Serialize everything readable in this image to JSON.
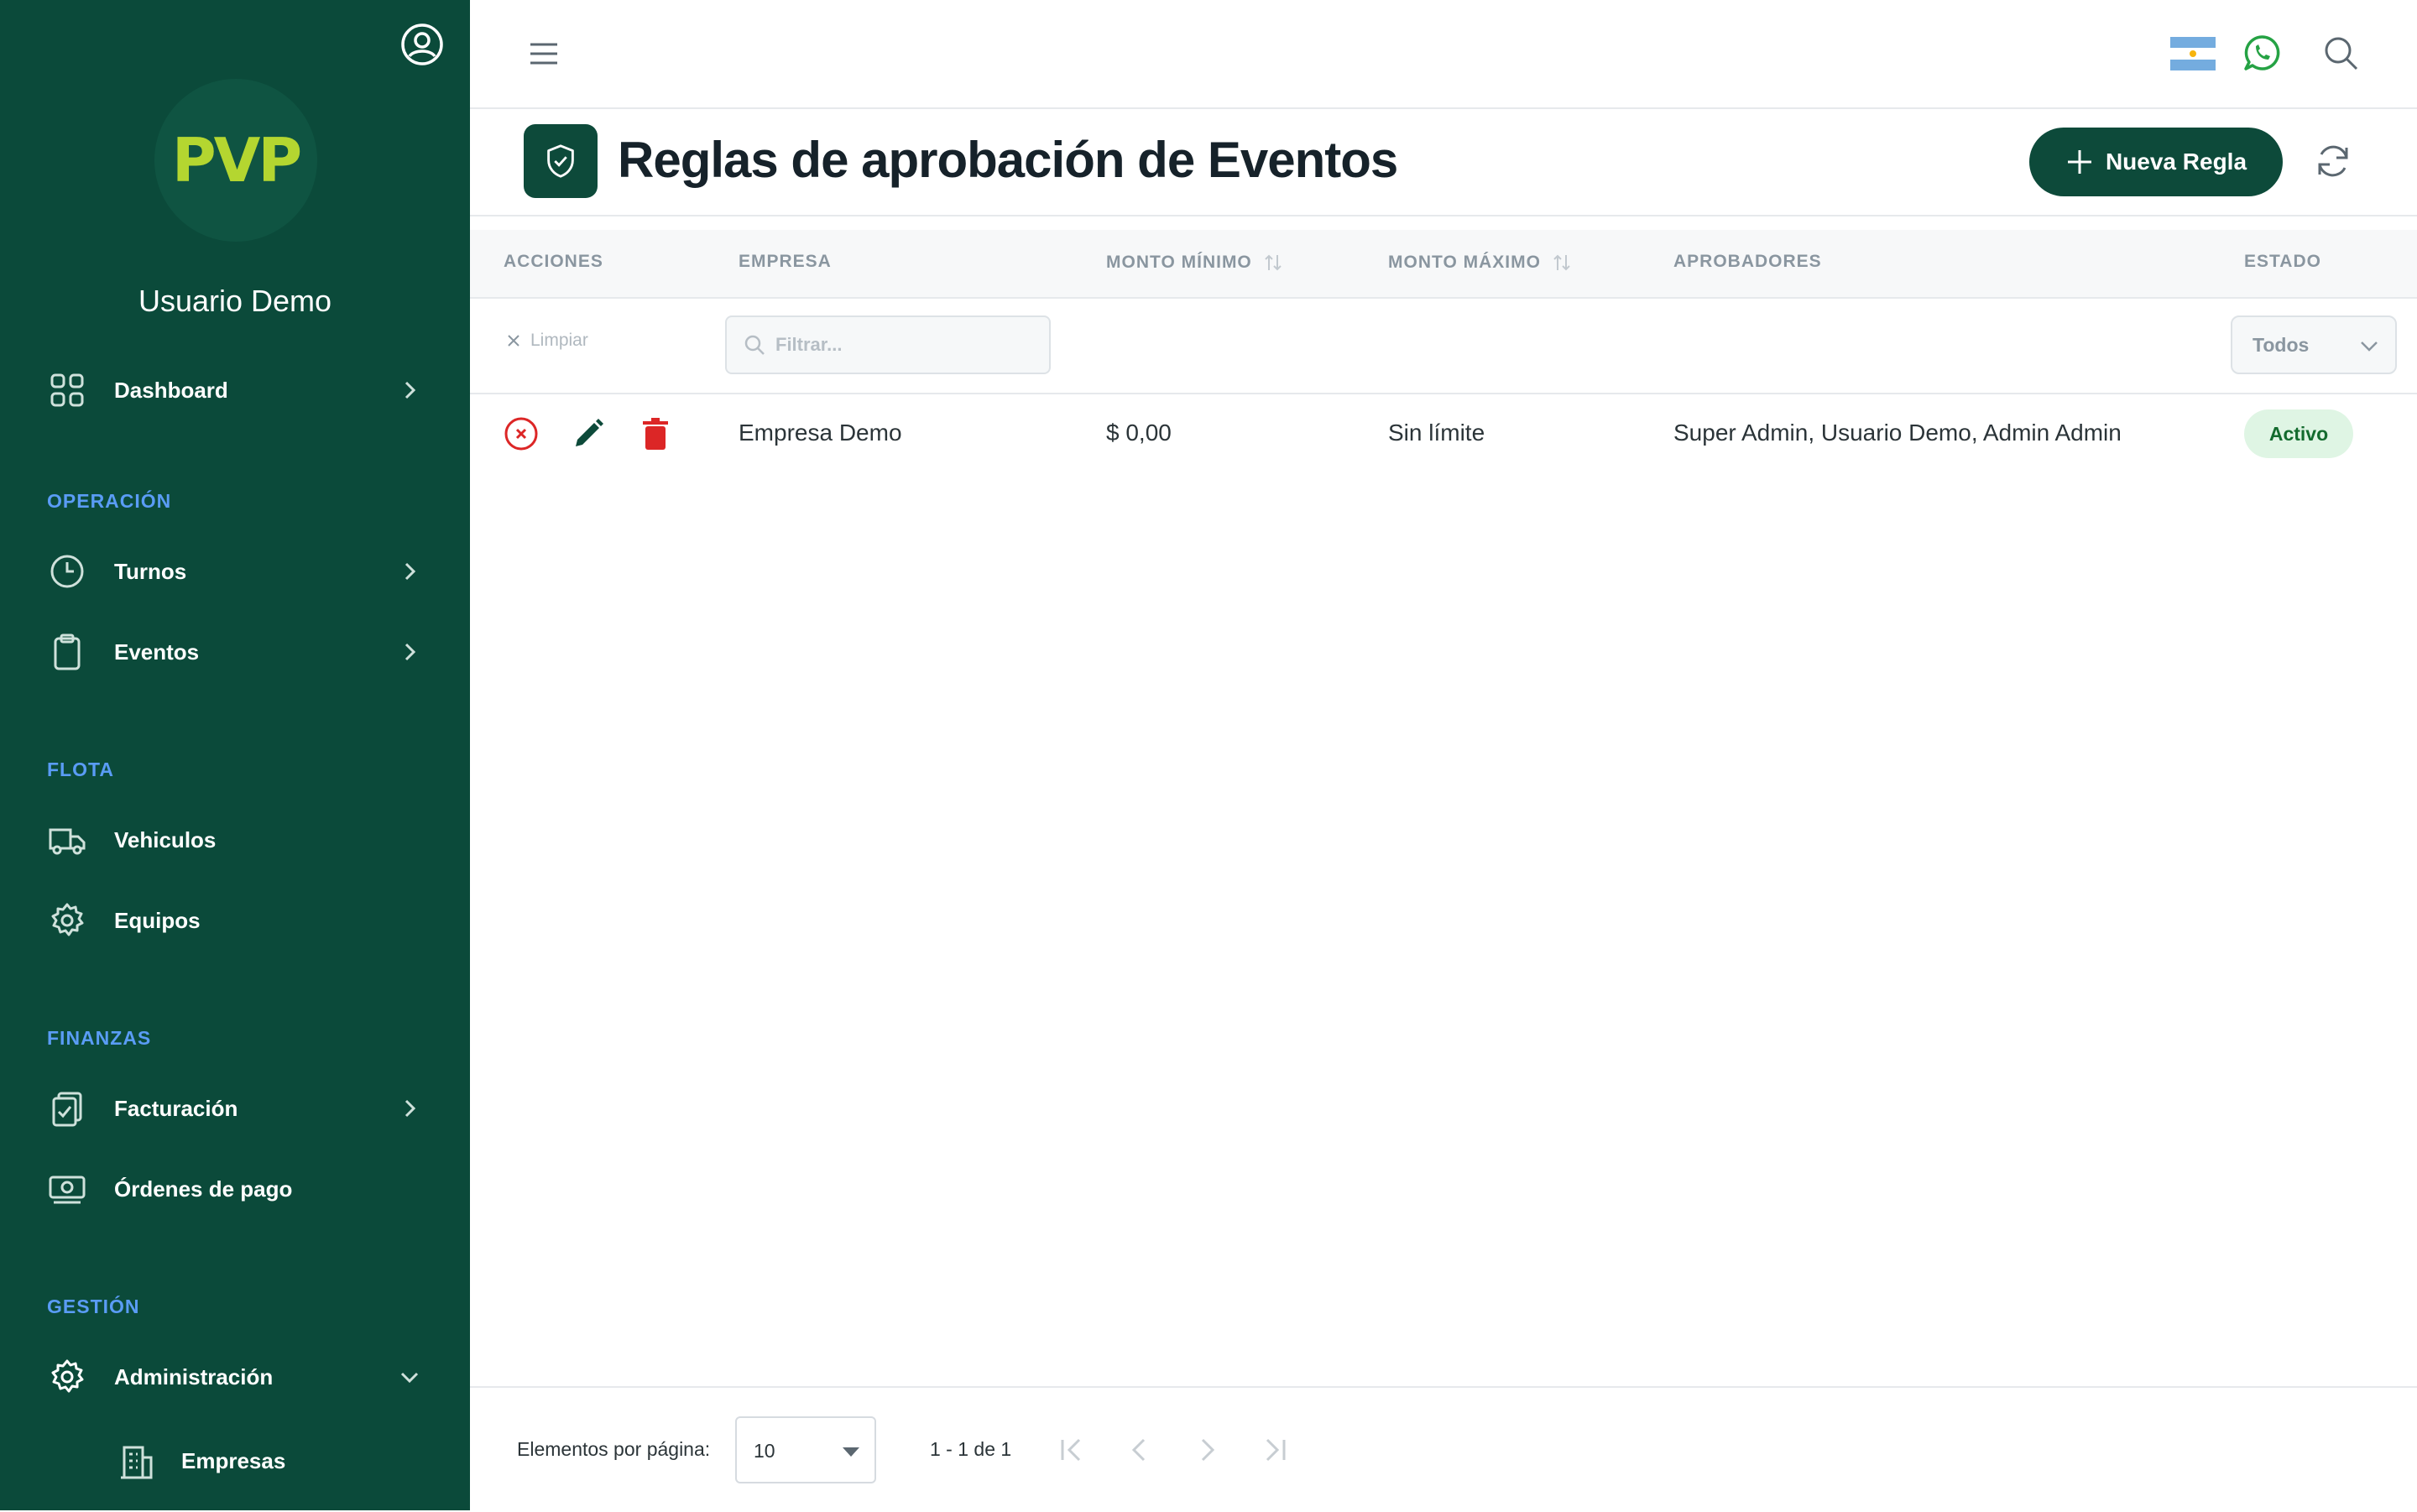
{
  "sidebar": {
    "logo_text": "PVP",
    "user_name": "Usuario Demo",
    "items": {
      "dashboard": "Dashboard",
      "turnos": "Turnos",
      "eventos": "Eventos",
      "vehiculos": "Vehiculos",
      "equipos": "Equipos",
      "facturacion": "Facturación",
      "ordenes": "Órdenes de pago",
      "administracion": "Administración",
      "empresas": "Empresas"
    },
    "sections": {
      "operacion": "OPERACIÓN",
      "flota": "FLOTA",
      "finanzas": "FINANZAS",
      "gestion": "GESTIÓN"
    }
  },
  "page": {
    "title": "Reglas de aprobación de Eventos",
    "new_button": "Nueva Regla"
  },
  "table": {
    "headers": {
      "acciones": "ACCIONES",
      "empresa": "EMPRESA",
      "monto_minimo": "MONTO MÍNIMO",
      "monto_maximo": "MONTO MÁXIMO",
      "aprobadores": "APROBADORES",
      "estado": "ESTADO"
    },
    "filters": {
      "clear_label": "Limpiar",
      "empresa_placeholder": "Filtrar...",
      "estado_value": "Todos"
    },
    "rows": [
      {
        "empresa": "Empresa Demo",
        "monto_minimo": "$ 0,00",
        "monto_maximo": "Sin límite",
        "aprobadores": "Super Admin, Usuario Demo, Admin Admin",
        "estado": "Activo"
      }
    ]
  },
  "paginator": {
    "per_page_label": "Elementos por página:",
    "per_page_value": "10",
    "range": "1 - 1 de 1"
  },
  "colors": {
    "sidebar": "#0b4a3a",
    "primary": "#0d4a3a",
    "logo": "#b4d630",
    "section_title": "#5a9cf5",
    "danger": "#dc2626",
    "whatsapp": "#25a244",
    "active_badge_bg": "#dff5e4"
  }
}
